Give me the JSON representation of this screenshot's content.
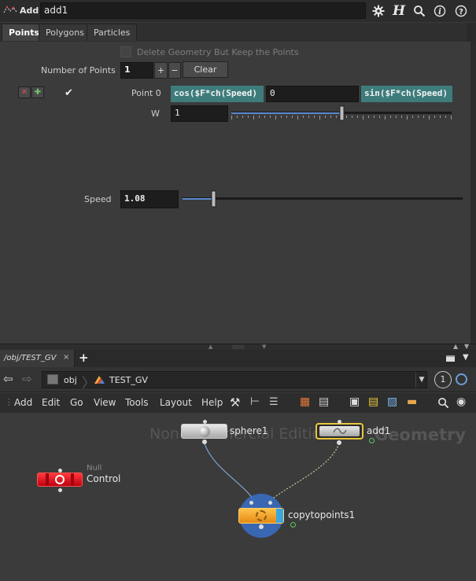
{
  "header": {
    "node_type_label": "Add",
    "node_name": "add1",
    "icons": [
      "gear-icon",
      "houdini-help-icon",
      "search-icon",
      "info-icon",
      "help-icon"
    ]
  },
  "tabs": [
    {
      "label": "Points",
      "active": true
    },
    {
      "label": "Polygons",
      "active": false
    },
    {
      "label": "Particles",
      "active": false
    }
  ],
  "params": {
    "delete_geometry_label": "Delete Geometry But Keep the Points",
    "number_of_points_label": "Number of Points",
    "number_of_points_value": "1",
    "plus_label": "+",
    "minus_label": "−",
    "clear_label": "Clear",
    "point0_label": "Point 0",
    "point0_x": "cos($F*ch(Speed)",
    "point0_y": "0",
    "point0_z": "sin($F*ch(Speed)",
    "w_label": "W",
    "w_value": "1",
    "w_slider_level": 0.5,
    "speed_label": "Speed",
    "speed_value": "1.08",
    "speed_slider_level": 0.11
  },
  "network": {
    "tab_label": "/obj/TEST_GV",
    "tab_close": "×",
    "tab_add": "+",
    "path_obj": "obj",
    "path_current": "TEST_GV",
    "pane_number": "1",
    "menu": [
      "Add",
      "Edit",
      "Go",
      "View",
      "Tools",
      "Layout",
      "Help"
    ],
    "watermark": "Non-Commercial Edition",
    "context_label": "Geometry",
    "nodes": {
      "sphere_label": "sphere1",
      "add_label": "add1",
      "null_type": "Null",
      "null_label": "Control",
      "copy_label": "copytopoints1"
    },
    "colors": {
      "expression_bg": "#3e7c7c",
      "null_node": "#e0141c",
      "copy_node": "#f4a623",
      "selected_outline": "#e8c83a",
      "copy_display_ring": "#3a70c8"
    }
  }
}
